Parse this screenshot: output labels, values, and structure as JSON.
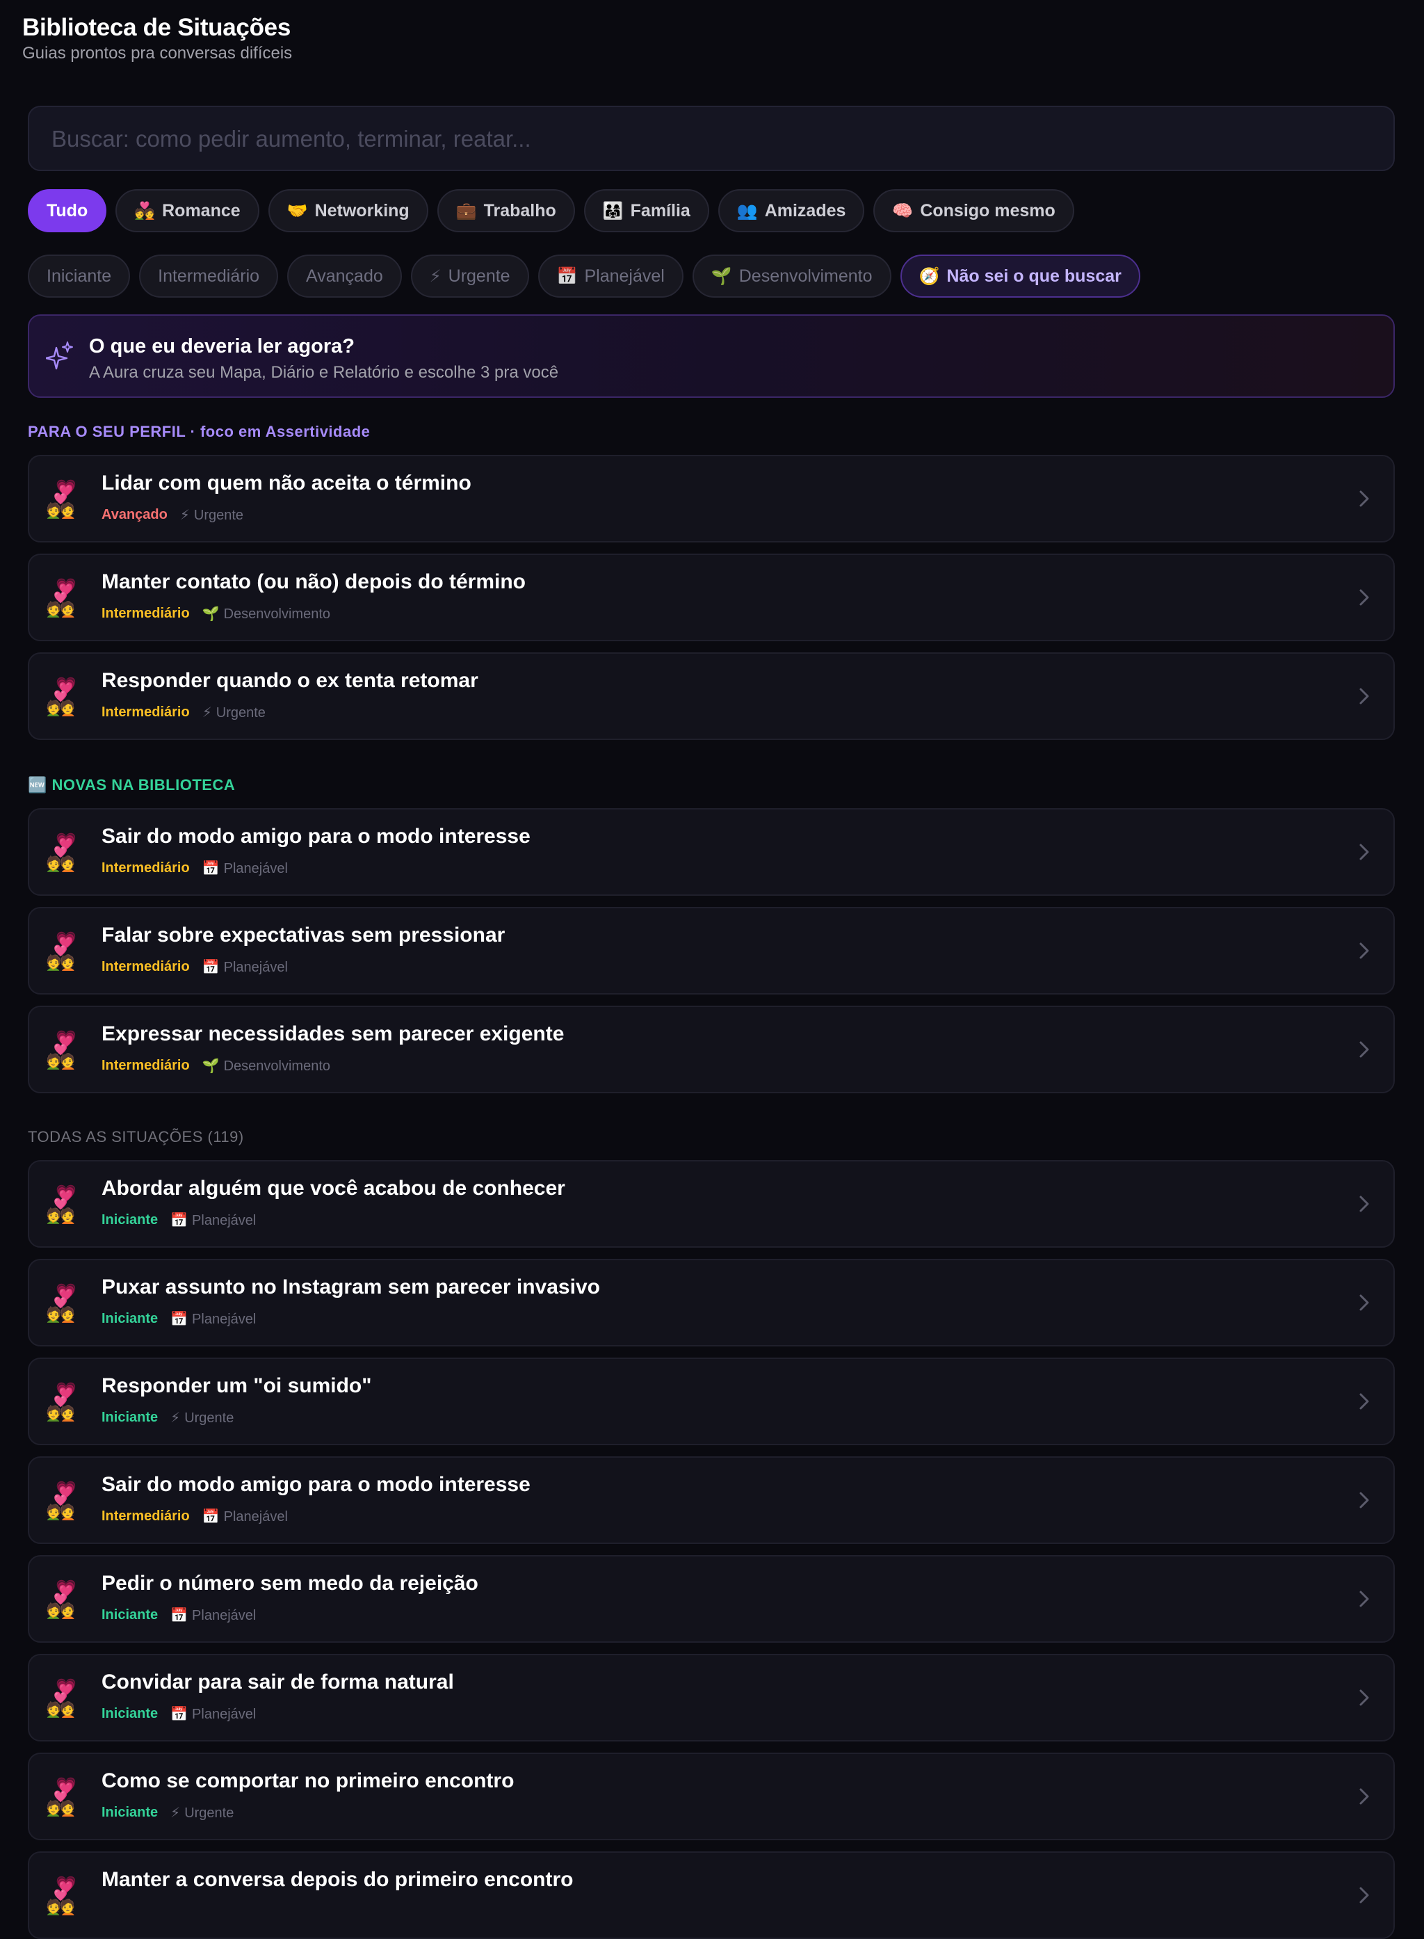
{
  "header": {
    "title": "Biblioteca de Situações",
    "subtitle": "Guias prontos pra conversas difíceis"
  },
  "search": {
    "placeholder": "Buscar: como pedir aumento, terminar, reatar..."
  },
  "categories": [
    {
      "icon": "",
      "label": "Tudo"
    },
    {
      "icon": "💑",
      "label": "Romance"
    },
    {
      "icon": "🤝",
      "label": "Networking"
    },
    {
      "icon": "💼",
      "label": "Trabalho"
    },
    {
      "icon": "👨‍👩‍👧",
      "label": "Família"
    },
    {
      "icon": "👥",
      "label": "Amizades"
    },
    {
      "icon": "🧠",
      "label": "Consigo mesmo"
    }
  ],
  "filters": [
    {
      "icon": "",
      "label": "Iniciante"
    },
    {
      "icon": "",
      "label": "Intermediário"
    },
    {
      "icon": "",
      "label": "Avançado"
    },
    {
      "icon": "⚡",
      "label": "Urgente"
    },
    {
      "icon": "📅",
      "label": "Planejável"
    },
    {
      "icon": "🌱",
      "label": "Desenvolvimento"
    },
    {
      "icon": "🧭",
      "label": "Não sei o que buscar"
    }
  ],
  "suggest": {
    "title": "O que eu deveria ler agora?",
    "subtitle": "A Aura cruza seu Mapa, Diário e Relatório e escolhe 3 pra você"
  },
  "sections": {
    "profile": "PARA O SEU PERFIL · foco em Assertividade",
    "new": "🆕 NOVAS NA BIBLIOTECA",
    "all": "TODAS AS SITUAÇÕES (119)"
  },
  "profile_cards": [
    {
      "title": "Lidar com quem não aceita o término",
      "level": "Avançado",
      "tag_icon": "⚡",
      "tag": "Urgente"
    },
    {
      "title": "Manter contato (ou não) depois do término",
      "level": "Intermediário",
      "tag_icon": "🌱",
      "tag": "Desenvolvimento"
    },
    {
      "title": "Responder quando o ex tenta retomar",
      "level": "Intermediário",
      "tag_icon": "⚡",
      "tag": "Urgente"
    }
  ],
  "new_cards": [
    {
      "title": "Sair do modo amigo para o modo interesse",
      "level": "Intermediário",
      "tag_icon": "📅",
      "tag": "Planejável"
    },
    {
      "title": "Falar sobre expectativas sem pressionar",
      "level": "Intermediário",
      "tag_icon": "📅",
      "tag": "Planejável"
    },
    {
      "title": "Expressar necessidades sem parecer exigente",
      "level": "Intermediário",
      "tag_icon": "🌱",
      "tag": "Desenvolvimento"
    }
  ],
  "all_cards": [
    {
      "title": "Abordar alguém que você acabou de conhecer",
      "level": "Iniciante",
      "tag_icon": "📅",
      "tag": "Planejável"
    },
    {
      "title": "Puxar assunto no Instagram sem parecer invasivo",
      "level": "Iniciante",
      "tag_icon": "📅",
      "tag": "Planejável"
    },
    {
      "title": "Responder um \"oi sumido\"",
      "level": "Iniciante",
      "tag_icon": "⚡",
      "tag": "Urgente"
    },
    {
      "title": "Sair do modo amigo para o modo interesse",
      "level": "Intermediário",
      "tag_icon": "📅",
      "tag": "Planejável"
    },
    {
      "title": "Pedir o número sem medo da rejeição",
      "level": "Iniciante",
      "tag_icon": "📅",
      "tag": "Planejável"
    },
    {
      "title": "Convidar para sair de forma natural",
      "level": "Iniciante",
      "tag_icon": "📅",
      "tag": "Planejável"
    },
    {
      "title": "Como se comportar no primeiro encontro",
      "level": "Iniciante",
      "tag_icon": "⚡",
      "tag": "Urgente"
    },
    {
      "title": "Manter a conversa depois do primeiro encontro",
      "level": "",
      "tag_icon": "",
      "tag": ""
    }
  ],
  "card_emoji": {
    "heart": "💗",
    "couple": "💑"
  },
  "colors": {
    "accent": "#7c3aed",
    "advanced": "#f87171",
    "intermediate": "#fbbf24",
    "beginner": "#34d399",
    "section_profile": "#a78bfa",
    "section_new": "#34d399"
  }
}
